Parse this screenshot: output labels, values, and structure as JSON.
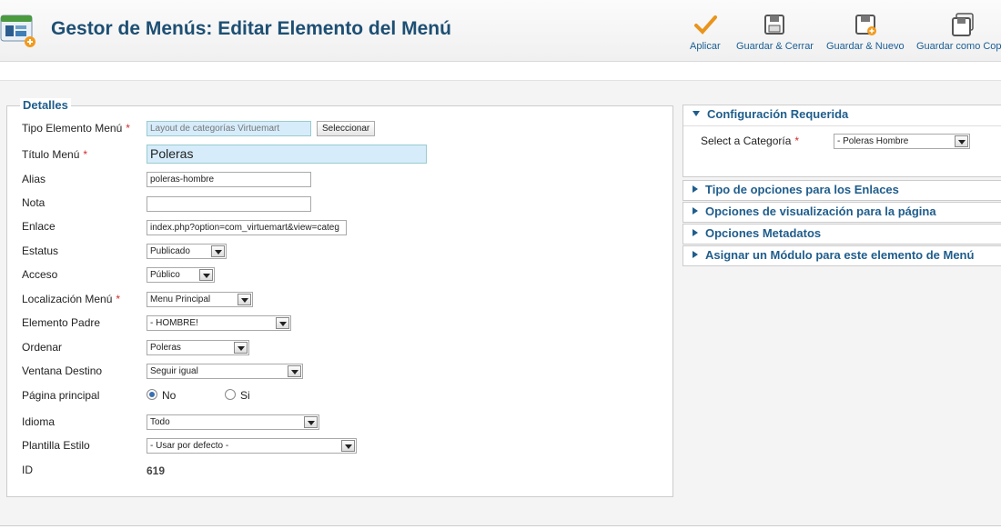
{
  "header": {
    "title": "Gestor de Menús: Editar Elemento del Menú",
    "buttons": [
      {
        "label": "Aplicar",
        "icon": "check-icon"
      },
      {
        "label": "Guardar & Cerrar",
        "icon": "save-close-icon"
      },
      {
        "label": "Guardar & Nuevo",
        "icon": "save-new-icon"
      },
      {
        "label": "Guardar como Copia",
        "icon": "save-copy-icon"
      }
    ]
  },
  "details": {
    "legend": "Detalles",
    "required_mark": "*",
    "menu_item_type": {
      "label": "Tipo Elemento Menú",
      "value": "Layout de categorías Virtuemart",
      "select_button": "Seleccionar"
    },
    "menu_title": {
      "label": "Título Menú",
      "value": "Poleras"
    },
    "alias": {
      "label": "Alias",
      "value": "poleras-hombre"
    },
    "note": {
      "label": "Nota",
      "value": ""
    },
    "link": {
      "label": "Enlace",
      "value": "index.php?option=com_virtuemart&view=categ"
    },
    "status": {
      "label": "Estatus",
      "value": "Publicado"
    },
    "access": {
      "label": "Acceso",
      "value": "Público"
    },
    "menu_location": {
      "label": "Localización Menú",
      "value": "Menu Principal"
    },
    "parent_item": {
      "label": "Elemento Padre",
      "value": "- HOMBRE!"
    },
    "ordering": {
      "label": "Ordenar",
      "value": "Poleras"
    },
    "target_window": {
      "label": "Ventana Destino",
      "value": "Seguir igual"
    },
    "home_page": {
      "label": "Página principal",
      "options": [
        "No",
        "Si"
      ],
      "selected": "No"
    },
    "language": {
      "label": "Idioma",
      "value": "Todo"
    },
    "template_style": {
      "label": "Plantilla Estilo",
      "value": "- Usar por defecto -"
    },
    "id": {
      "label": "ID",
      "value": "619"
    }
  },
  "right_panel": {
    "required_config": {
      "title": "Configuración Requerida",
      "category_label": "Select a Categoría",
      "category_value": "- Poleras Hombre"
    },
    "sections": [
      "Tipo de opciones para los Enlaces",
      "Opciones de visualización para la página",
      "Opciones Metadatos",
      "Asignar un Módulo para este elemento de Menú"
    ]
  },
  "colors": {
    "title": "#1d4f73",
    "accent": "#1f5d8c",
    "required": "#d12d2d",
    "highlight_field": "#d6ecfb"
  }
}
